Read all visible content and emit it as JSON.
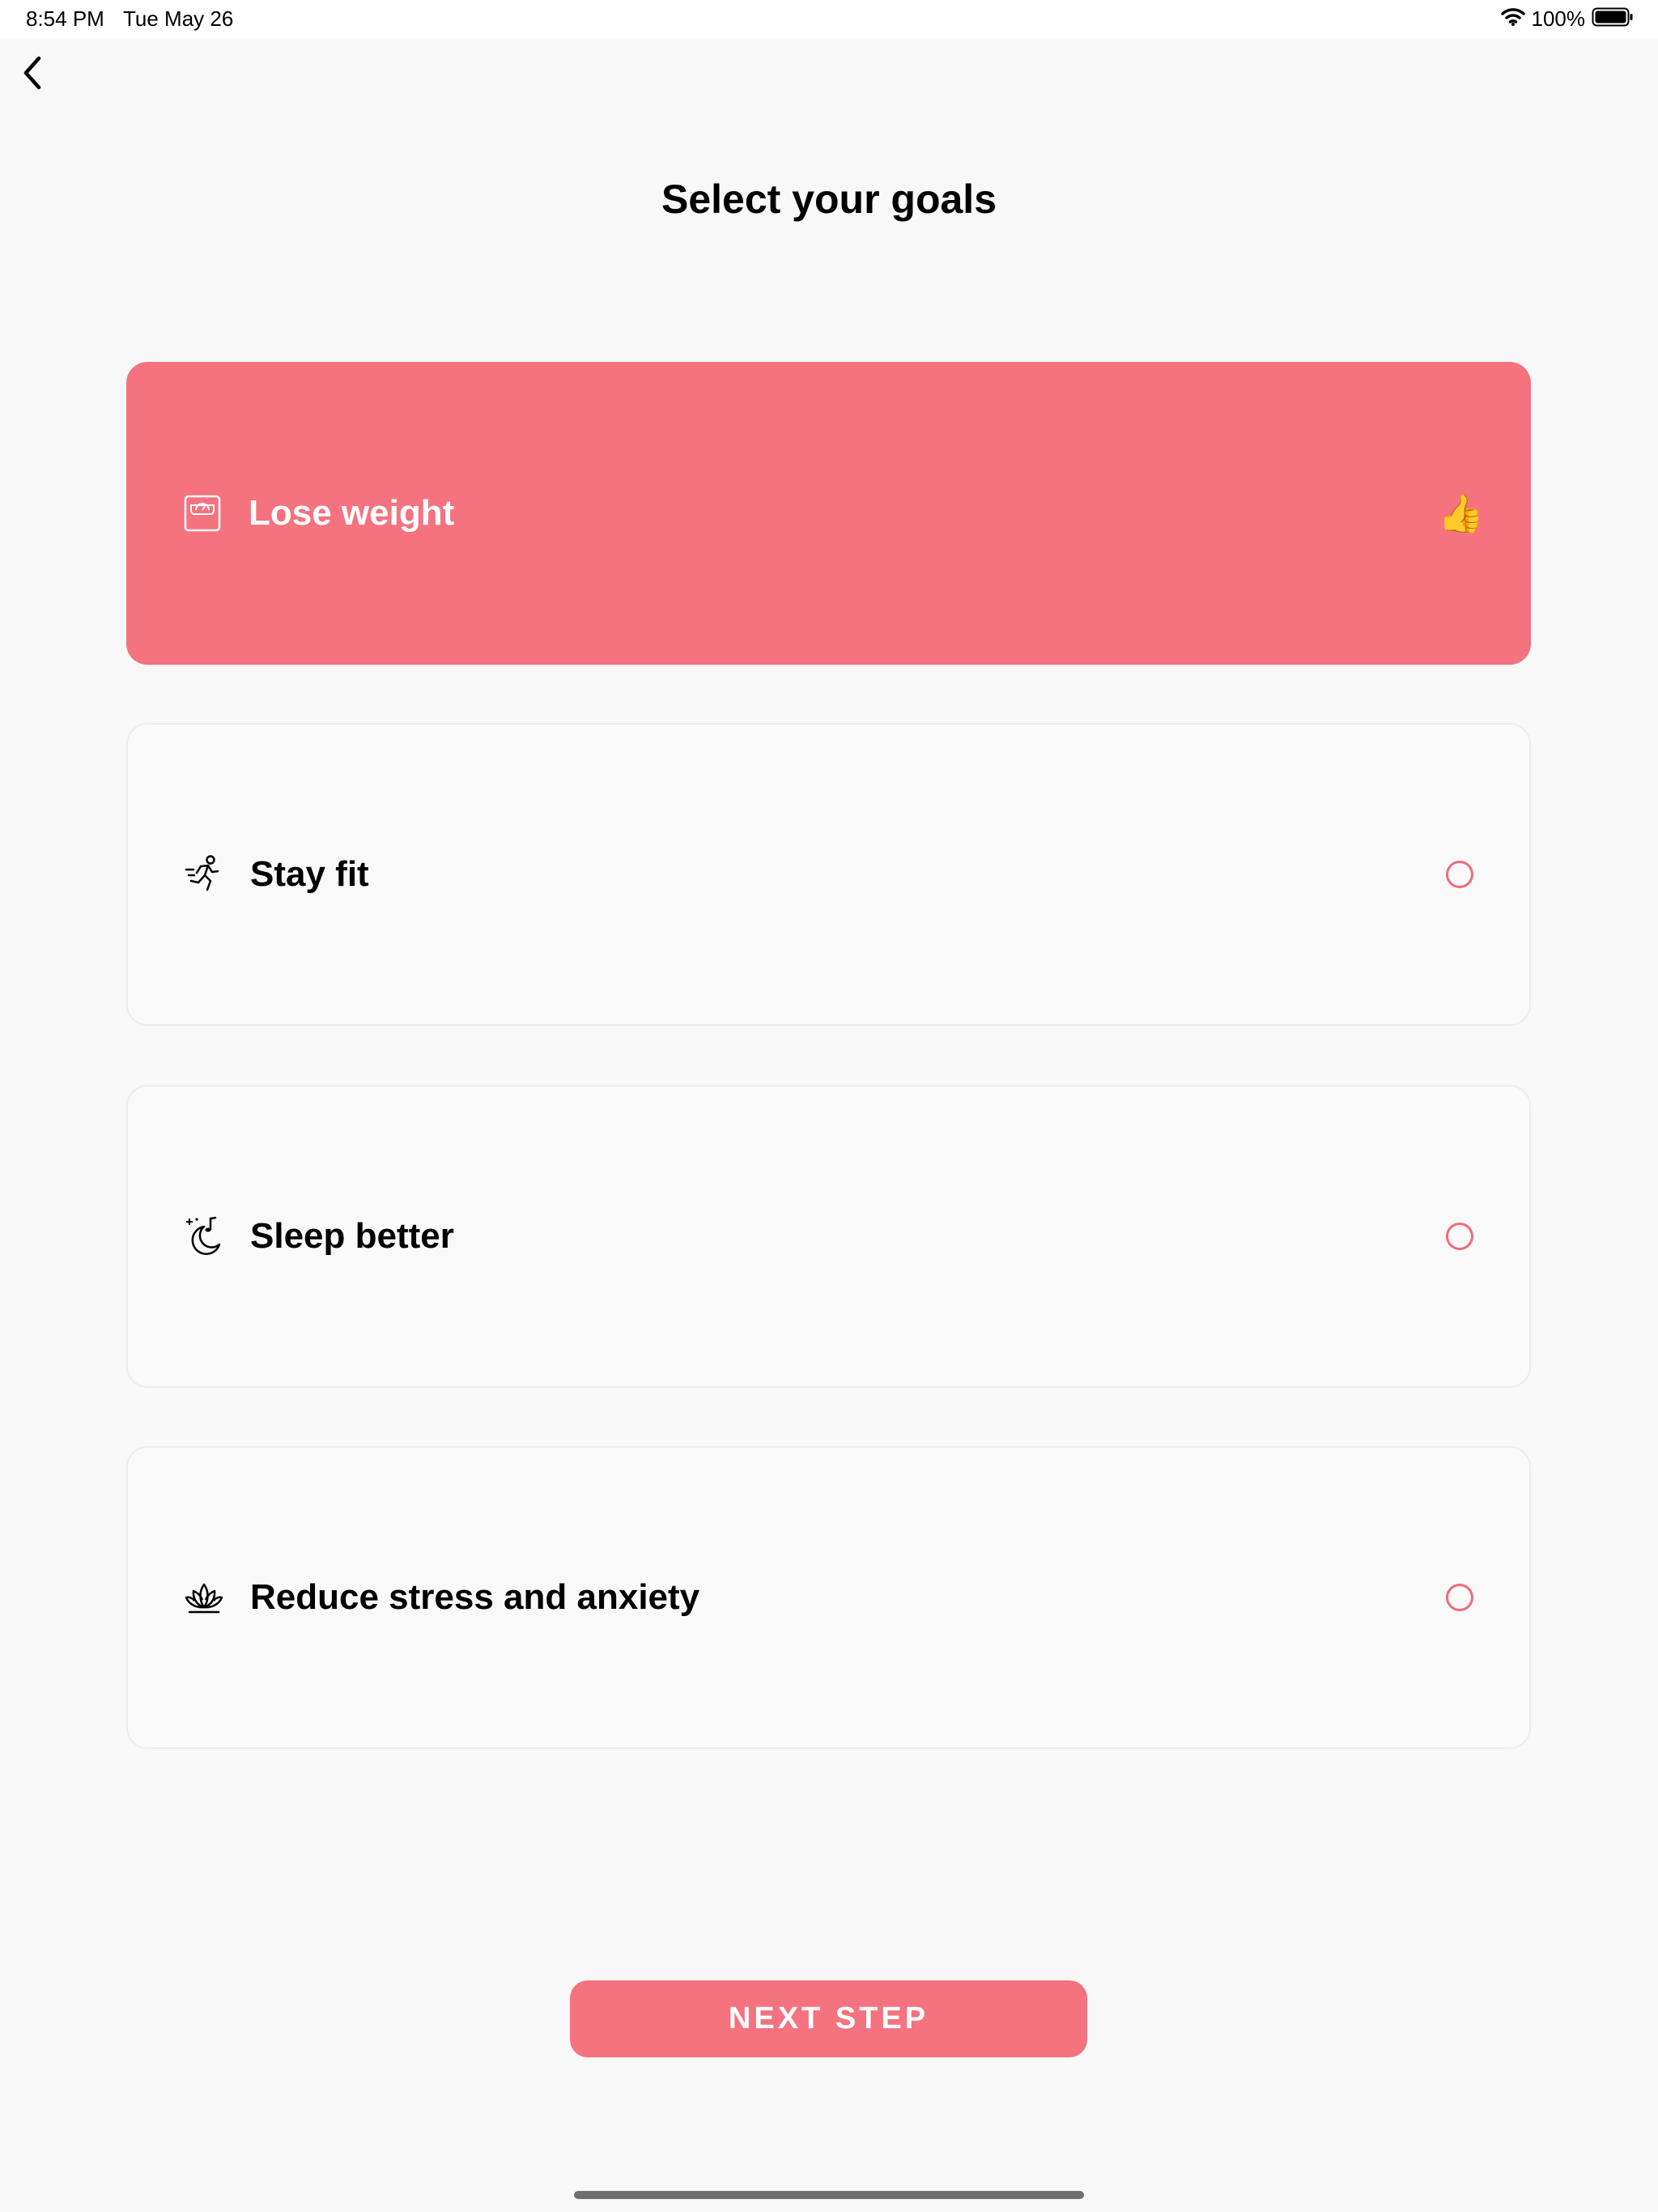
{
  "status_bar": {
    "time": "8:54 PM",
    "date": "Tue May 26",
    "battery": "100%"
  },
  "header": {
    "title": "Select your goals"
  },
  "goals": [
    {
      "label": "Lose weight",
      "icon": "scale-icon",
      "selected": true
    },
    {
      "label": "Stay fit",
      "icon": "running-icon",
      "selected": false
    },
    {
      "label": "Sleep better",
      "icon": "moon-sleep-icon",
      "selected": false
    },
    {
      "label": "Reduce stress and anxiety",
      "icon": "lotus-icon",
      "selected": false
    }
  ],
  "footer": {
    "next_label": "NEXT STEP"
  },
  "colors": {
    "accent": "#f5727f",
    "background": "#f8f8f8",
    "card": "#f9f9f9"
  }
}
